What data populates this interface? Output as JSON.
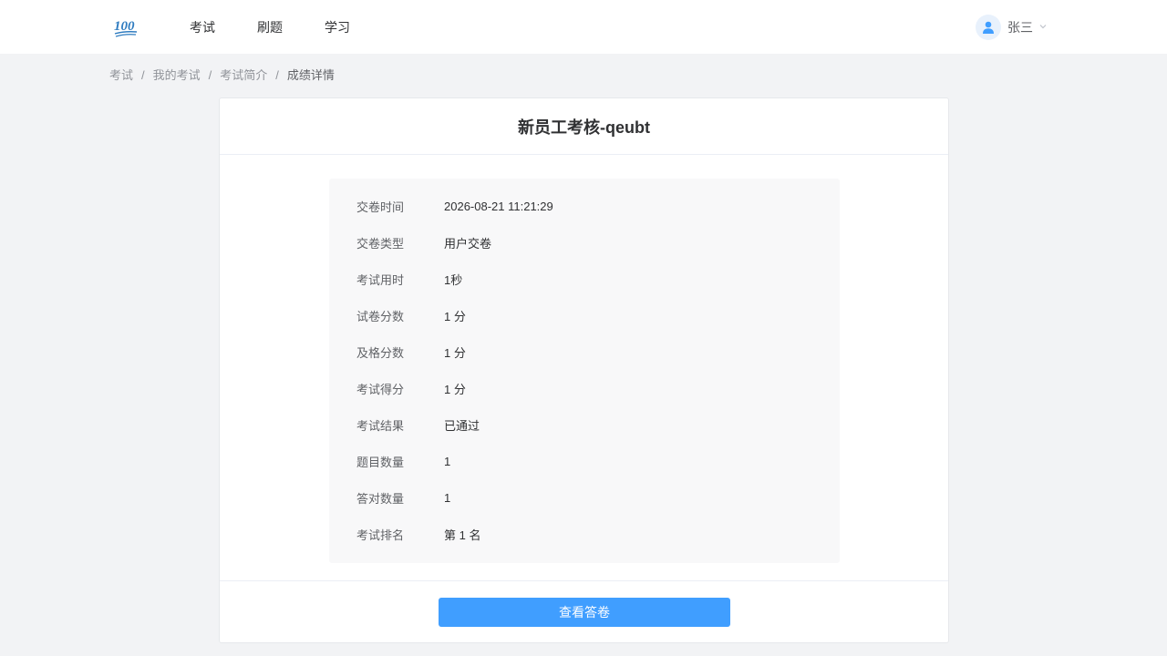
{
  "header": {
    "logo_text": "100",
    "nav": [
      {
        "label": "考试"
      },
      {
        "label": "刷题"
      },
      {
        "label": "学习"
      }
    ],
    "user": {
      "name": "张三",
      "avatar_icon": "user-icon",
      "dropdown_icon": "chevron-down-icon"
    }
  },
  "breadcrumb": [
    {
      "label": "考试"
    },
    {
      "label": "我的考试"
    },
    {
      "label": "考试简介"
    },
    {
      "label": "成绩详情"
    }
  ],
  "breadcrumb_separator": "/",
  "card": {
    "title": "新员工考核-qeubt",
    "rows": [
      {
        "label": "交卷时间",
        "value": "2026-08-21 11:21:29"
      },
      {
        "label": "交卷类型",
        "value": "用户交卷"
      },
      {
        "label": "考试用时",
        "value": "1秒"
      },
      {
        "label": "试卷分数",
        "value": "1 分"
      },
      {
        "label": "及格分数",
        "value": "1 分"
      },
      {
        "label": "考试得分",
        "value": "1 分"
      },
      {
        "label": "考试结果",
        "value": "已通过"
      },
      {
        "label": "题目数量",
        "value": "1"
      },
      {
        "label": "答对数量",
        "value": "1"
      },
      {
        "label": "考试排名",
        "value": "第 1 名"
      }
    ],
    "action_label": "查看答卷"
  },
  "colors": {
    "accent": "#409eff",
    "page_bg": "#f2f3f5",
    "panel_bg": "#f8f8f9"
  }
}
